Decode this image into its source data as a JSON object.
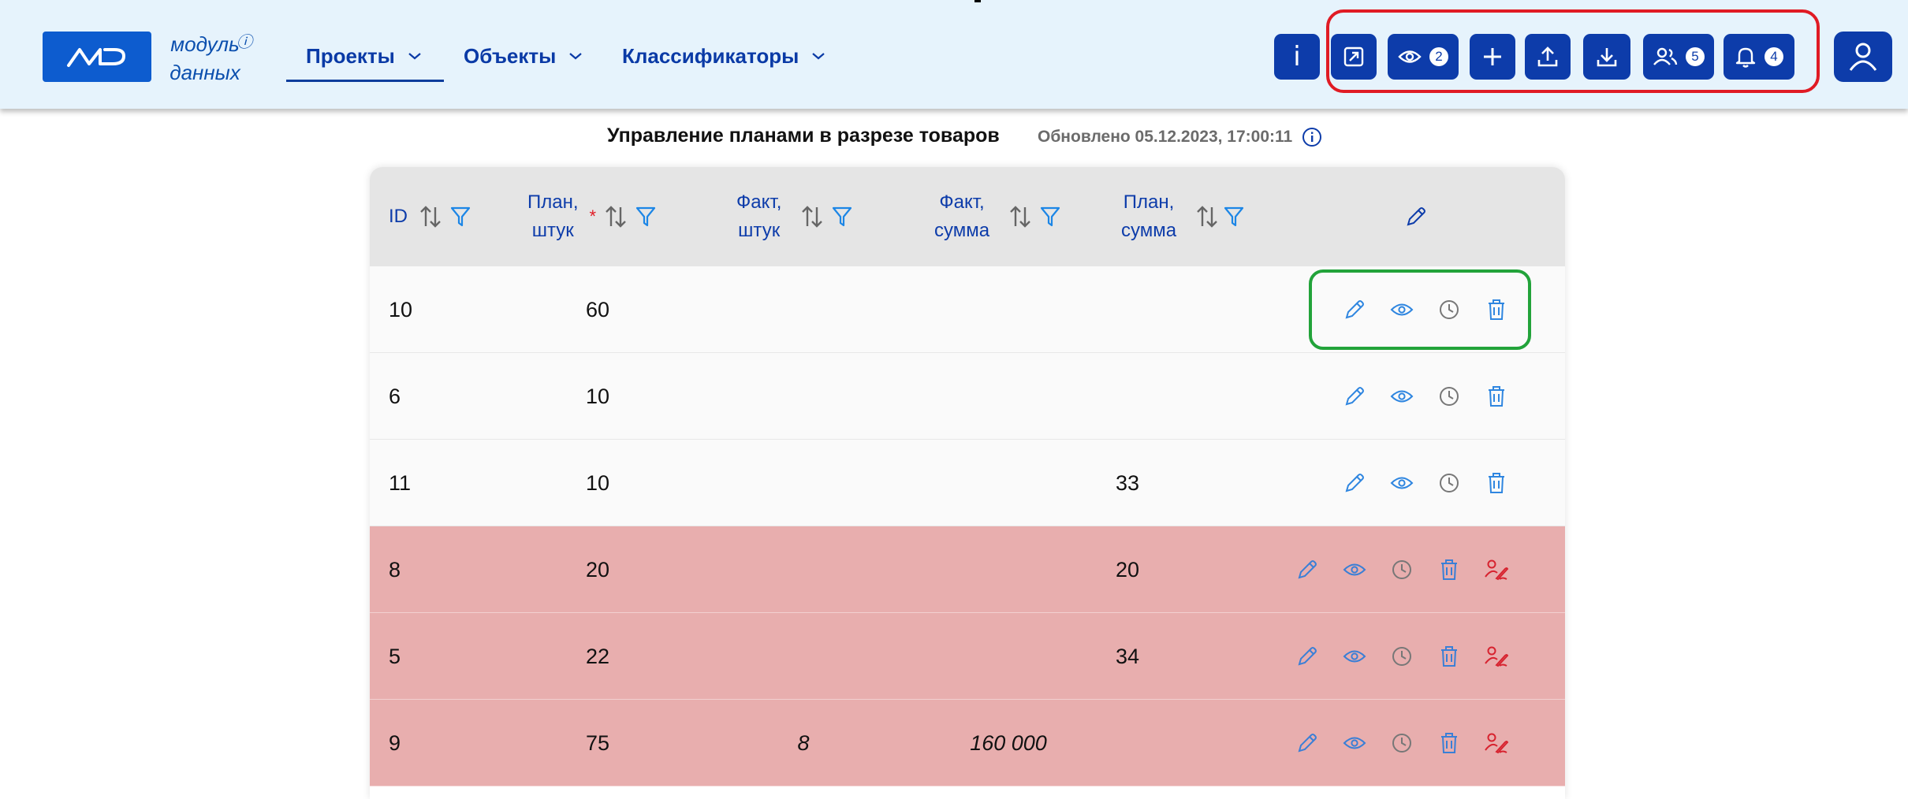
{
  "header": {
    "logo_text": "MD",
    "logo_label_line1": "модуль",
    "logo_label_line2": "данных",
    "logo_info_symbol": "ⓘ",
    "nav": [
      {
        "label": "Проекты",
        "active": true
      },
      {
        "label": "Объекты",
        "active": false
      },
      {
        "label": "Классификаторы",
        "active": false
      }
    ],
    "info_button_label": "i",
    "view_badge": "2",
    "users_badge": "5",
    "notifications_badge": "4",
    "accent_color": "#0d3caa"
  },
  "page": {
    "title": "Управление планами в разрезе товаров",
    "updated": "Обновлено 05.12.2023, 17:00:11"
  },
  "table": {
    "columns": [
      {
        "label": "ID",
        "sortable": true,
        "filterable": true
      },
      {
        "label": "План,\nштук",
        "required": true,
        "required_mark": "*",
        "sortable": true,
        "filterable": true
      },
      {
        "label": "Факт,\nштук",
        "sortable": true,
        "filterable": true
      },
      {
        "label": "Факт,\nсумма",
        "sortable": true,
        "filterable": true
      },
      {
        "label": "План,\nсумма",
        "sortable": true,
        "filterable": true
      },
      {
        "label": "",
        "icon": "pencil-icon"
      }
    ],
    "rows": [
      {
        "id": "10",
        "plan_qty": "60",
        "fact_qty": "",
        "fact_sum": "",
        "plan_sum": "",
        "highlight": false
      },
      {
        "id": "6",
        "plan_qty": "10",
        "fact_qty": "",
        "fact_sum": "",
        "plan_sum": "",
        "highlight": false
      },
      {
        "id": "11",
        "plan_qty": "10",
        "fact_qty": "",
        "fact_sum": "",
        "plan_sum": "33",
        "highlight": false
      },
      {
        "id": "8",
        "plan_qty": "20",
        "fact_qty": "",
        "fact_sum": "",
        "plan_sum": "20",
        "highlight": true
      },
      {
        "id": "5",
        "plan_qty": "22",
        "fact_qty": "",
        "fact_sum": "",
        "plan_sum": "34",
        "highlight": true
      },
      {
        "id": "9",
        "plan_qty": "75",
        "fact_qty": "8",
        "fact_sum": "160 000",
        "plan_sum": "",
        "highlight": true
      }
    ],
    "row_actions": [
      "edit-icon",
      "view-icon",
      "history-icon",
      "delete-icon"
    ],
    "highlight_extra_action": "sign-icon",
    "highlight_color": "#e8aeae"
  }
}
